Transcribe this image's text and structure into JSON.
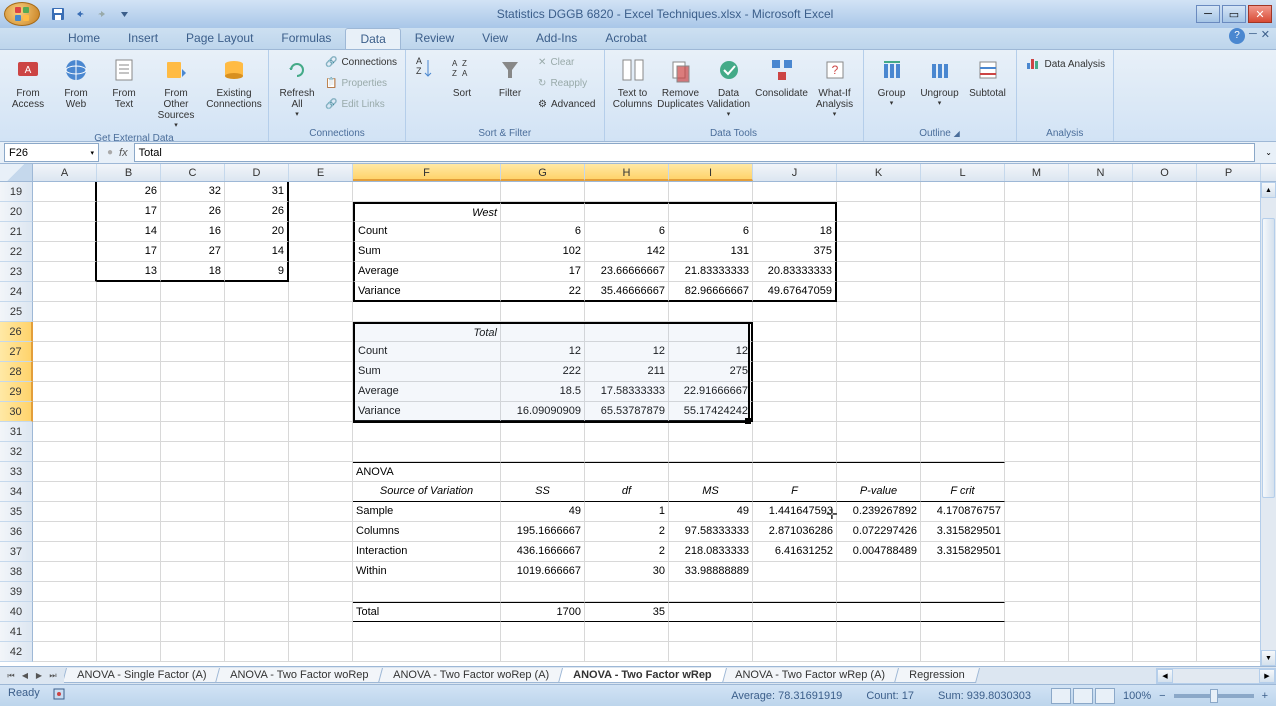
{
  "window": {
    "title": "Statistics DGGB 6820 - Excel Techniques.xlsx - Microsoft Excel"
  },
  "ribbon_tabs": [
    "Home",
    "Insert",
    "Page Layout",
    "Formulas",
    "Data",
    "Review",
    "View",
    "Add-Ins",
    "Acrobat"
  ],
  "active_tab": "Data",
  "ribbon": {
    "get_external": {
      "from_access": "From Access",
      "from_web": "From Web",
      "from_text": "From Text",
      "from_other": "From Other Sources",
      "existing": "Existing Connections",
      "label": "Get External Data"
    },
    "connections": {
      "refresh": "Refresh All",
      "connections": "Connections",
      "properties": "Properties",
      "edit_links": "Edit Links",
      "label": "Connections"
    },
    "sort_filter": {
      "sort": "Sort",
      "filter": "Filter",
      "clear": "Clear",
      "reapply": "Reapply",
      "advanced": "Advanced",
      "label": "Sort & Filter"
    },
    "data_tools": {
      "text_to_cols": "Text to Columns",
      "remove_dup": "Remove Duplicates",
      "validation": "Data Validation",
      "consolidate": "Consolidate",
      "whatif": "What-If Analysis",
      "label": "Data Tools"
    },
    "outline": {
      "group": "Group",
      "ungroup": "Ungroup",
      "subtotal": "Subtotal",
      "label": "Outline"
    },
    "analysis": {
      "data_analysis": "Data Analysis",
      "label": "Analysis"
    }
  },
  "name_box": "F26",
  "formula": "Total",
  "columns": [
    "A",
    "B",
    "C",
    "D",
    "E",
    "F",
    "G",
    "H",
    "I",
    "J",
    "K",
    "L",
    "M",
    "N",
    "O",
    "P"
  ],
  "selected_cols": [
    "F",
    "G",
    "H",
    "I"
  ],
  "rows": [
    19,
    20,
    21,
    22,
    23,
    24,
    25,
    26,
    27,
    28,
    29,
    30,
    31,
    32,
    33,
    34,
    35,
    36,
    37,
    38,
    39,
    40,
    41,
    42
  ],
  "selected_rows": [
    26,
    27,
    28,
    29,
    30
  ],
  "data": {
    "19": {
      "B": "26",
      "C": "32",
      "D": "31"
    },
    "20": {
      "B": "17",
      "C": "26",
      "D": "26",
      "F_italic": "West"
    },
    "21": {
      "B": "14",
      "C": "16",
      "D": "20",
      "F": "Count",
      "G": "6",
      "H": "6",
      "I": "6",
      "J": "18"
    },
    "22": {
      "B": "17",
      "C": "27",
      "D": "14",
      "F": "Sum",
      "G": "102",
      "H": "142",
      "I": "131",
      "J": "375"
    },
    "23": {
      "B": "13",
      "C": "18",
      "D": "9",
      "F": "Average",
      "G": "17",
      "H": "23.66666667",
      "I": "21.83333333",
      "J": "20.83333333"
    },
    "24": {
      "F": "Variance",
      "G": "22",
      "H": "35.46666667",
      "I": "82.96666667",
      "J": "49.67647059"
    },
    "26": {
      "F_italic": "Total"
    },
    "27": {
      "F": "Count",
      "G": "12",
      "H": "12",
      "I": "12"
    },
    "28": {
      "F": "Sum",
      "G": "222",
      "H": "211",
      "I": "275"
    },
    "29": {
      "F": "Average",
      "G": "18.5",
      "H": "17.58333333",
      "I": "22.91666667"
    },
    "30": {
      "F": "Variance",
      "G": "16.09090909",
      "H": "65.53787879",
      "I": "55.17424242"
    },
    "33": {
      "F": "ANOVA"
    },
    "34": {
      "F_ci": "Source of Variation",
      "G_ci": "SS",
      "H_ci": "df",
      "I_ci": "MS",
      "J_ci": "F",
      "K_ci": "P-value",
      "L_ci": "F crit"
    },
    "35": {
      "F": "Sample",
      "G": "49",
      "H": "1",
      "I": "49",
      "J": "1.441647593",
      "K": "0.239267892",
      "L": "4.170876757"
    },
    "36": {
      "F": "Columns",
      "G": "195.1666667",
      "H": "2",
      "I": "97.58333333",
      "J": "2.871036286",
      "K": "0.072297426",
      "L": "3.315829501"
    },
    "37": {
      "F": "Interaction",
      "G": "436.1666667",
      "H": "2",
      "I": "218.0833333",
      "J": "6.41631252",
      "K": "0.004788489",
      "L": "3.315829501"
    },
    "38": {
      "F": "Within",
      "G": "1019.666667",
      "H": "30",
      "I": "33.98888889"
    },
    "40": {
      "F": "Total",
      "G": "1700",
      "H": "35"
    }
  },
  "sheet_tabs": [
    {
      "name": "ANOVA - Single Factor (A)",
      "active": false
    },
    {
      "name": "ANOVA - Two Factor woRep",
      "active": false
    },
    {
      "name": "ANOVA - Two Factor woRep (A)",
      "active": false
    },
    {
      "name": "ANOVA - Two Factor wRep",
      "active": true
    },
    {
      "name": "ANOVA - Two Factor wRep (A)",
      "active": false
    },
    {
      "name": "Regression",
      "active": false
    }
  ],
  "status": {
    "ready": "Ready",
    "average": "Average: 78.31691919",
    "count": "Count: 17",
    "sum": "Sum: 939.8030303",
    "zoom": "100%"
  }
}
